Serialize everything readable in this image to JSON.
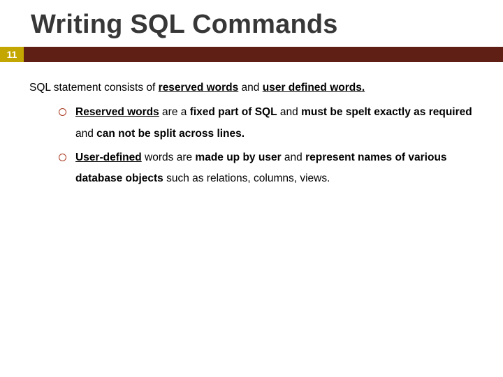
{
  "title": "Writing SQL Commands",
  "slide_number": "11",
  "intro": {
    "p1": "SQL statement consists of ",
    "rw": "reserved words",
    "and": " and ",
    "udw": "user defined words."
  },
  "bullets": [
    {
      "lead_u": "Reserved words",
      "t1": " are a ",
      "b1": "fixed part of SQL",
      "t2": " and ",
      "b2": "must be spelt exactly as required",
      "t3": " and ",
      "b3": "can not be split across lines."
    },
    {
      "lead_u": "User-defined",
      "t1": " words are ",
      "b1": "made up by user",
      "t2": " and ",
      "b2": "represent names of various database objects",
      "t3": " such as relations, columns, views.",
      "b3": ""
    }
  ]
}
